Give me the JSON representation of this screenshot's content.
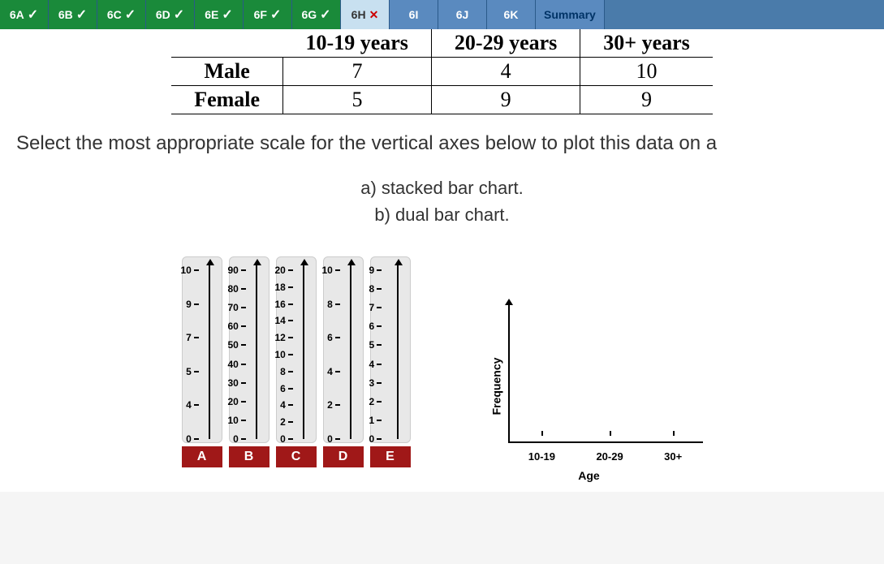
{
  "tabs": [
    {
      "label": "6A",
      "state": "correct"
    },
    {
      "label": "6B",
      "state": "correct"
    },
    {
      "label": "6C",
      "state": "correct"
    },
    {
      "label": "6D",
      "state": "correct"
    },
    {
      "label": "6E",
      "state": "correct"
    },
    {
      "label": "6F",
      "state": "correct"
    },
    {
      "label": "6G",
      "state": "correct"
    },
    {
      "label": "6H",
      "state": "wrong"
    },
    {
      "label": "6I",
      "state": "pending"
    },
    {
      "label": "6J",
      "state": "pending"
    },
    {
      "label": "6K",
      "state": "pending"
    },
    {
      "label": "Summary",
      "state": "summary"
    }
  ],
  "table": {
    "headers": [
      "",
      "10-19 years",
      "20-29 years",
      "30+ years"
    ],
    "rows": [
      {
        "label": "Male",
        "values": [
          7,
          4,
          10
        ]
      },
      {
        "label": "Female",
        "values": [
          5,
          9,
          9
        ]
      }
    ]
  },
  "question_text": "Select the most appropriate scale for the vertical axes below to plot this data on a",
  "subparts": {
    "a": "a) stacked bar chart.",
    "b": "b) dual bar chart."
  },
  "scales": [
    {
      "letter": "A",
      "ticks": [
        10,
        9,
        7,
        5,
        4,
        0
      ]
    },
    {
      "letter": "B",
      "ticks": [
        90,
        80,
        70,
        60,
        50,
        40,
        30,
        20,
        10,
        0
      ]
    },
    {
      "letter": "C",
      "ticks": [
        20,
        18,
        16,
        14,
        12,
        10,
        8,
        6,
        4,
        2,
        0
      ]
    },
    {
      "letter": "D",
      "ticks": [
        10,
        8,
        6,
        4,
        2,
        0
      ]
    },
    {
      "letter": "E",
      "ticks": [
        9,
        8,
        7,
        6,
        5,
        4,
        3,
        2,
        1,
        0
      ]
    }
  ],
  "blank_chart": {
    "ylabel": "Frequency",
    "xlabel": "Age",
    "xticks": [
      "10-19",
      "20-29",
      "30+"
    ]
  },
  "chart_data": {
    "type": "table",
    "title": "Frequency by gender and age group",
    "categories": [
      "10-19 years",
      "20-29 years",
      "30+ years"
    ],
    "series": [
      {
        "name": "Male",
        "values": [
          7,
          4,
          10
        ]
      },
      {
        "name": "Female",
        "values": [
          5,
          9,
          9
        ]
      }
    ],
    "scale_options": {
      "A": [
        10,
        9,
        7,
        5,
        4,
        0
      ],
      "B": [
        90,
        80,
        70,
        60,
        50,
        40,
        30,
        20,
        10,
        0
      ],
      "C": [
        20,
        18,
        16,
        14,
        12,
        10,
        8,
        6,
        4,
        2,
        0
      ],
      "D": [
        10,
        8,
        6,
        4,
        2,
        0
      ],
      "E": [
        9,
        8,
        7,
        6,
        5,
        4,
        3,
        2,
        1,
        0
      ]
    }
  }
}
